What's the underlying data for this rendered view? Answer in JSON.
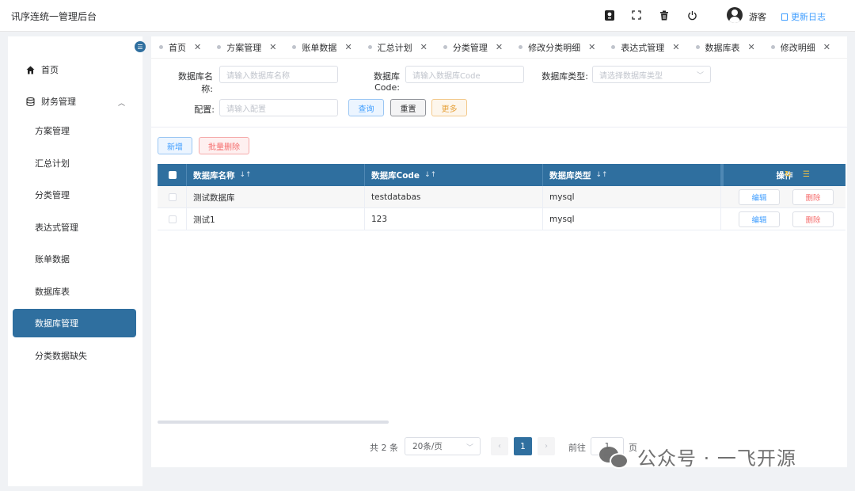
{
  "header": {
    "title": "讯序连统一管理后台",
    "icons": [
      "robot-icon",
      "fullscreen-icon",
      "trash-icon",
      "power-icon"
    ],
    "user": "游客",
    "changelog": "更新日志"
  },
  "sidebar": {
    "items": [
      {
        "label": "首页",
        "icon": "home-icon"
      },
      {
        "label": "财务管理",
        "icon": "database-icon",
        "expanded": true
      },
      {
        "label": "方案管理"
      },
      {
        "label": "汇总计划"
      },
      {
        "label": "分类管理"
      },
      {
        "label": "表达式管理"
      },
      {
        "label": "账单数据"
      },
      {
        "label": "数据库表"
      },
      {
        "label": "数据库管理",
        "active": true
      },
      {
        "label": "分类数据缺失"
      }
    ]
  },
  "tabs": [
    "首页",
    "方案管理",
    "账单数据",
    "汇总计划",
    "分类管理",
    "修改分类明细",
    "表达式管理",
    "数据库表",
    "修改明细"
  ],
  "form": {
    "db_name_label": "数据库名称:",
    "db_name_placeholder": "请输入数据库名称",
    "db_code_label": "数据库Code:",
    "db_code_placeholder": "请输入数据库Code",
    "db_type_label": "数据库类型:",
    "db_type_placeholder": "请选择数据库类型",
    "config_label": "配置:",
    "config_placeholder": "请输入配置",
    "query": "查询",
    "reset": "重置",
    "more": "更多"
  },
  "actions": {
    "add": "新增",
    "batch_delete": "批量删除"
  },
  "table": {
    "columns": [
      "数据库名称",
      "数据库Code",
      "数据库类型",
      "操作"
    ],
    "rows": [
      {
        "name": "测试数据库",
        "code": "testdatabas",
        "type": "mysql",
        "edit": "编辑",
        "delete": "删除"
      },
      {
        "name": "测试1",
        "code": "123",
        "type": "mysql",
        "edit": "编辑",
        "delete": "删除"
      }
    ]
  },
  "pagination": {
    "total": "共 2 条",
    "page_size": "20条/页",
    "current_page": "1",
    "goto_label": "前往",
    "goto_value": "1",
    "page_suffix": "页"
  },
  "watermark": "公众号 · 一飞开源"
}
